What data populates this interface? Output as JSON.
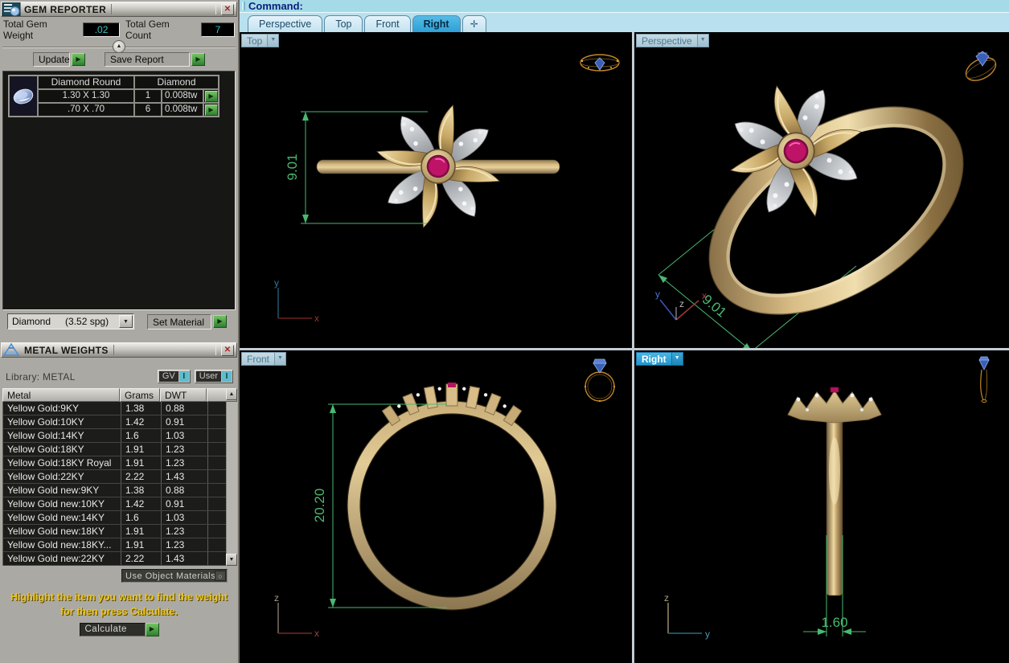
{
  "icons": {
    "go": "▶",
    "collapse": "▲",
    "scroll_up": "▲",
    "scroll_down": "▼",
    "dropdown": "▼",
    "close": "✕",
    "radio": "○",
    "toggle": "I"
  },
  "gem_reporter": {
    "title": "GEM REPORTER",
    "weight_label": "Total Gem Weight",
    "weight_value": ".02",
    "count_label": "Total Gem Count",
    "count_value": "7",
    "update_label": "Update",
    "save_label": "Save Report",
    "table": {
      "col_type": "Diamond Round",
      "col_gem": "Diamond",
      "rows": [
        {
          "size": "1.30 X 1.30",
          "qty": "1",
          "tw": "0.008tw"
        },
        {
          "size": ".70 X .70",
          "qty": "6",
          "tw": "0.008tw"
        }
      ]
    },
    "material_name": "Diamond",
    "material_spg": "(3.52 spg)",
    "set_material_label": "Set Material"
  },
  "metal_weights": {
    "title": "METAL WEIGHTS",
    "library_label": "Library:  METAL",
    "gv_label": "GV",
    "user_label": "User",
    "columns": [
      "Metal",
      "Grams",
      "DWT"
    ],
    "rows": [
      [
        "Yellow Gold:9KY",
        "1.38",
        "0.88"
      ],
      [
        "Yellow Gold:10KY",
        "1.42",
        "0.91"
      ],
      [
        "Yellow Gold:14KY",
        "1.6",
        "1.03"
      ],
      [
        "Yellow Gold:18KY",
        "1.91",
        "1.23"
      ],
      [
        "Yellow Gold:18KY Royal",
        "1.91",
        "1.23"
      ],
      [
        "Yellow Gold:22KY",
        "2.22",
        "1.43"
      ],
      [
        "Yellow Gold new:9KY",
        "1.38",
        "0.88"
      ],
      [
        "Yellow Gold new:10KY",
        "1.42",
        "0.91"
      ],
      [
        "Yellow Gold new:14KY",
        "1.6",
        "1.03"
      ],
      [
        "Yellow Gold new:18KY",
        "1.91",
        "1.23"
      ],
      [
        "Yellow Gold new:18KY...",
        "1.91",
        "1.23"
      ],
      [
        "Yellow Gold new:22KY",
        "2.22",
        "1.43"
      ]
    ],
    "use_object_materials": "Use Object Materials",
    "instruction": "Highlight the item you want to find the weight for then press Calculate.",
    "calculate_label": "Calculate"
  },
  "command_bar": {
    "label": "Command:"
  },
  "tab_strip": {
    "tabs": [
      {
        "label": "Perspective",
        "name": "perspective",
        "active": false
      },
      {
        "label": "Top",
        "name": "top",
        "active": false
      },
      {
        "label": "Front",
        "name": "front",
        "active": false
      },
      {
        "label": "Right",
        "name": "right",
        "active": true
      },
      {
        "label": "✛",
        "name": "new-viewport",
        "active": false
      }
    ]
  },
  "viewports": {
    "top": {
      "label": "Top",
      "dimension": "9.01",
      "axis_v": "y",
      "axis_h": "x"
    },
    "perspective": {
      "label": "Perspective",
      "dimension": "9.01",
      "axis_y": "y",
      "axis_z": "z",
      "axis_x": "x"
    },
    "front": {
      "label": "Front",
      "dimension": "20.20",
      "axis_v": "z",
      "axis_h": "x"
    },
    "right": {
      "label": "Right",
      "dimension": "1.60",
      "axis_v": "z",
      "axis_h": "y"
    }
  },
  "colors": {
    "dimension_green": "#49b96f",
    "ruby": "#bf1367",
    "gold": "#c9ae79",
    "tab_active_blue": "#38a9de"
  }
}
